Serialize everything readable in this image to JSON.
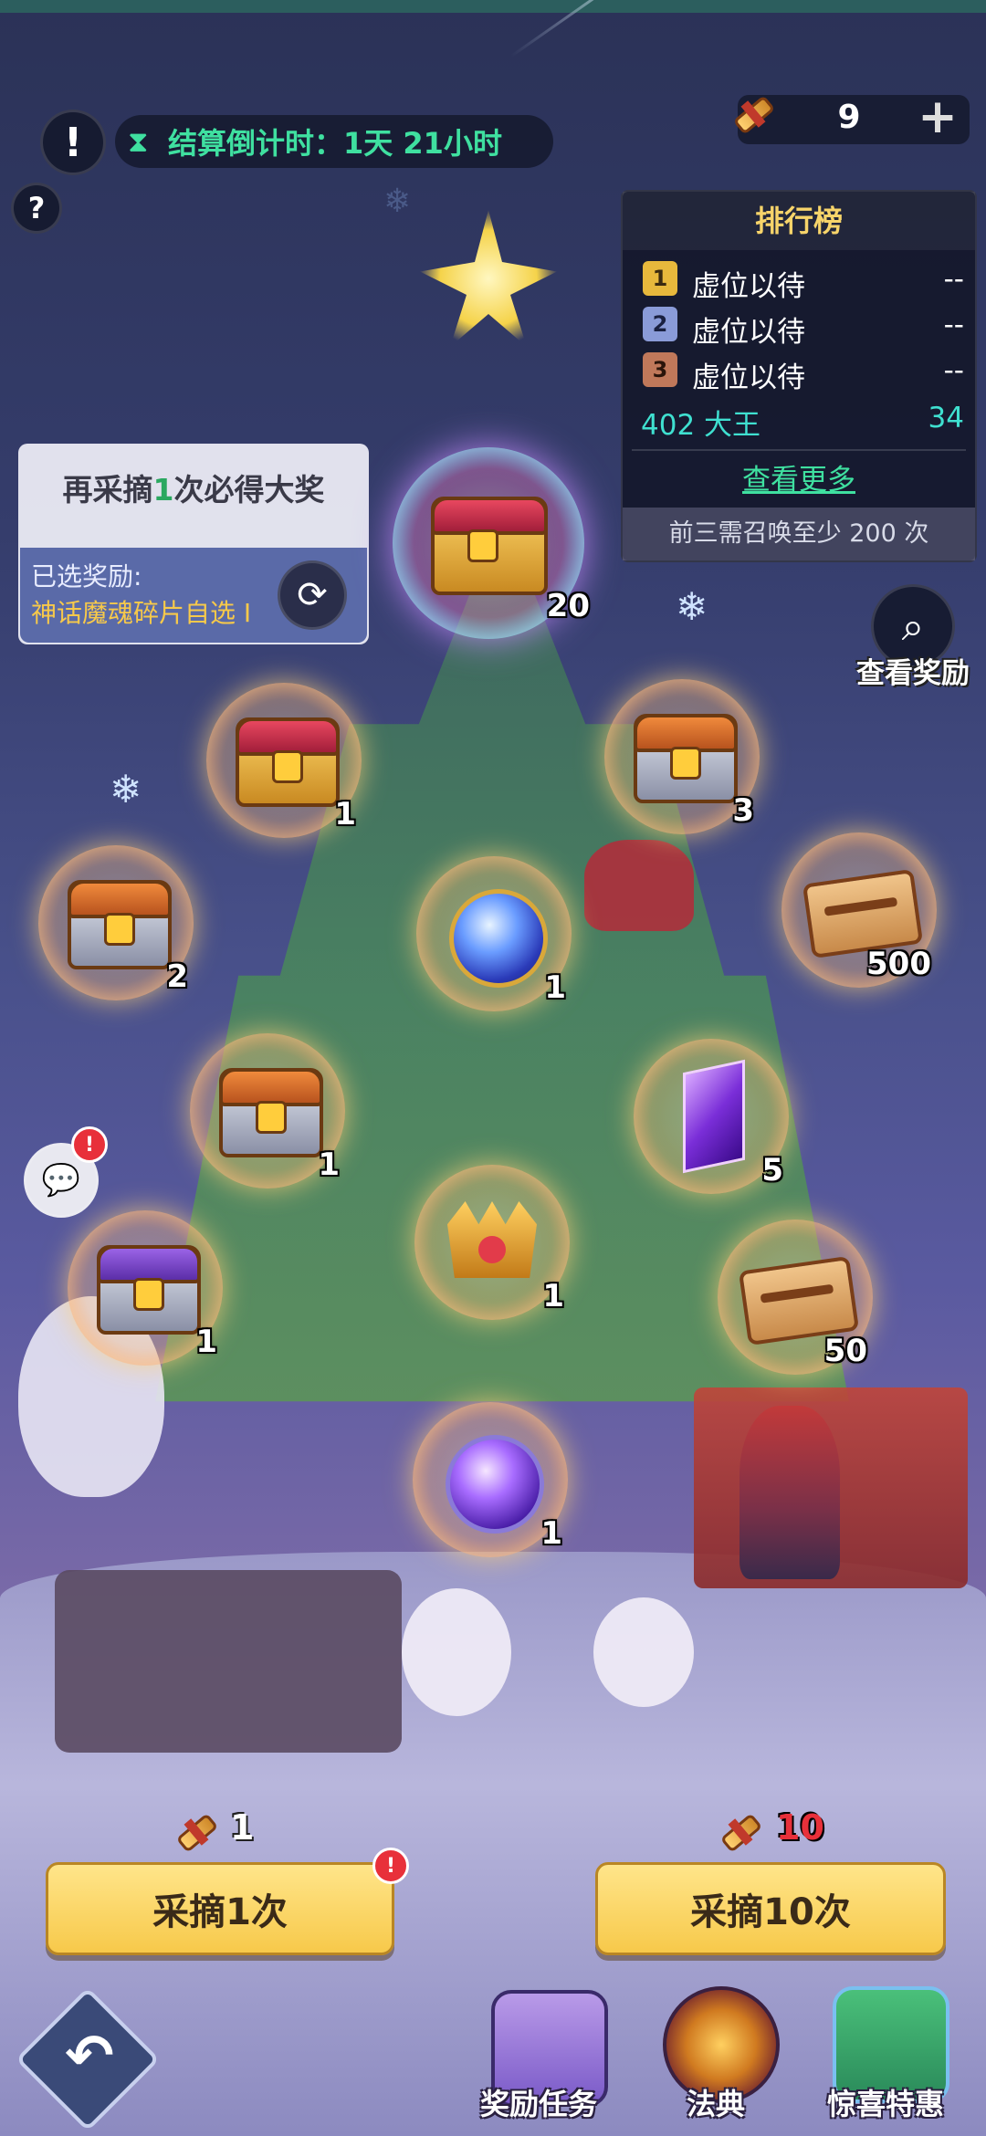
{
  "countdown": {
    "label": "结算倒计时：1天 21小时"
  },
  "currency": {
    "count": "9",
    "add_label": "+"
  },
  "leaderboard": {
    "title": "排行榜",
    "rows": [
      {
        "rank": "1",
        "name": "虚位以待",
        "score": "--"
      },
      {
        "rank": "2",
        "name": "虚位以待",
        "score": "--"
      },
      {
        "rank": "3",
        "name": "虚位以待",
        "score": "--"
      }
    ],
    "self": {
      "name": "402 大王",
      "score": "34"
    },
    "more_label": "查看更多",
    "footer": "前三需召唤至少 200 次"
  },
  "prize_panel": {
    "pre": "再采摘",
    "num": "1",
    "post": "次必得大奖",
    "selected_label": "已选奖励:",
    "selected_value": "神话魔魂碎片自选 I"
  },
  "view_rewards_label": "查看奖励",
  "grand_prize": {
    "count": "20"
  },
  "items": [
    {
      "kind": "chest-red",
      "count": "1"
    },
    {
      "kind": "chest-silver",
      "count": "3"
    },
    {
      "kind": "chest-silver",
      "count": "2"
    },
    {
      "kind": "orb-blue",
      "count": "1"
    },
    {
      "kind": "scroll",
      "count": "500"
    },
    {
      "kind": "chest-silver",
      "count": "1"
    },
    {
      "kind": "crystal",
      "count": "5"
    },
    {
      "kind": "crown",
      "count": "1"
    },
    {
      "kind": "chest-purple",
      "count": "1"
    },
    {
      "kind": "scroll",
      "count": "50"
    },
    {
      "kind": "orb-purple",
      "count": "1"
    }
  ],
  "pick_once": {
    "cost": "1",
    "label": "采摘1次",
    "badge": "!"
  },
  "pick_ten": {
    "cost": "10",
    "label": "采摘10次"
  },
  "nav": {
    "tasks_label": "奖励任务",
    "codex_label": "法典",
    "offers_label": "惊喜特惠"
  },
  "chat_badge": "!",
  "colors": {
    "accent_green": "#3fe0a0",
    "gold": "#f7c94a",
    "cost_red": "#e8303a"
  }
}
